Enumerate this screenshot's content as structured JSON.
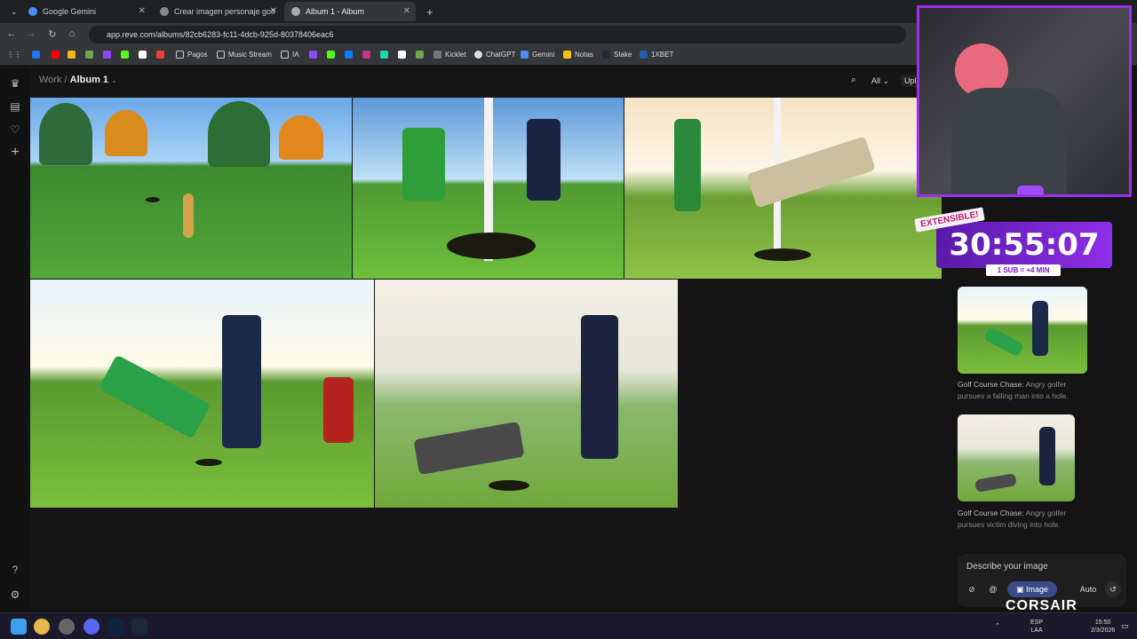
{
  "browser": {
    "tabs": [
      {
        "label": "Google Gemini",
        "active": false
      },
      {
        "label": "Crear imagen personaje golf",
        "active": false
      },
      {
        "label": "Album 1 - Album",
        "active": true
      }
    ],
    "url": "app.reve.com/albums/82cb6283-fc11-4dcb-925d-80378406eac6",
    "bookmarks": [
      "Pagos",
      "Music Stream",
      "IA",
      "Kicklet",
      "ChatGPT",
      "Gemini",
      "Notas",
      "Stake",
      "1XBET"
    ]
  },
  "app": {
    "breadcrumb": {
      "parent": "Work",
      "separator": "/",
      "current": "Album 1"
    },
    "filter_label": "All",
    "upload_label": "Upl"
  },
  "right_panel": {
    "items": [
      {
        "title": "Golf Course Chase:",
        "desc": "Angry golfer pursues a falling man into a hole."
      },
      {
        "title": "Golf Course Chase:",
        "desc": "Angry golfer pursues victim diving into hole."
      }
    ],
    "prompt_placeholder": "Describe your image",
    "image_button": "Image",
    "auto_label": "Auto"
  },
  "overlay": {
    "extensible": "EXTENSIBLE!",
    "timer": "30:55:07",
    "sub_rule": "1 SUB = +4 MIN",
    "brand": "CORSAIR"
  },
  "taskbar": {
    "lang": "ESP",
    "lang2": "LAA",
    "time": "15:50",
    "date": "2/3/2026"
  },
  "colors": {
    "accent": "#9b2ff0",
    "image_button": "#3a4a8a"
  }
}
